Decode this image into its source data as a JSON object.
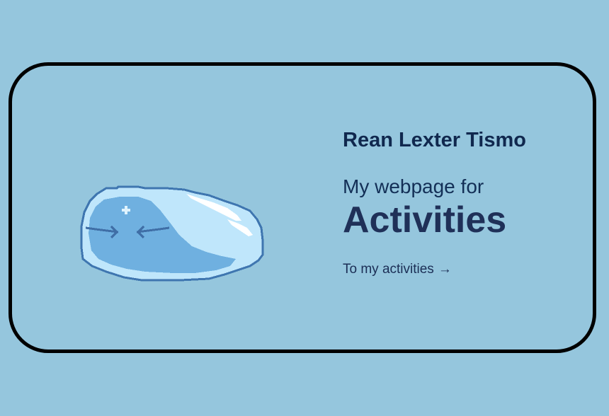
{
  "profile": {
    "name": "Rean Lexter Tismo"
  },
  "hero": {
    "subtitle": "My webpage for",
    "headline": "Activities"
  },
  "cta": {
    "label": "To my activities",
    "arrow": "→"
  },
  "icons": {
    "illustration": "pixel-slime-icon"
  },
  "colors": {
    "page_background": "#95c6dd",
    "card_border": "#000000",
    "text_dark": "#1b2e55",
    "slime_outline": "#3f76b0",
    "slime_light": "#bfe6fb",
    "slime_body": "#6fb0e0",
    "slime_highlight": "#ffffff"
  }
}
